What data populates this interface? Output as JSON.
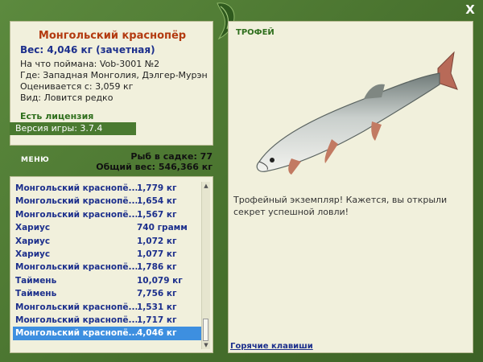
{
  "fish": {
    "title": "Монгольский краснопёр",
    "weight": "Вес: 4,046 кг (зачетная)",
    "caught_with": "На что поймана: Vob-3001 №2",
    "location": "Где: Западная Монголия, Дэлгер-Мурэн",
    "estimated_from": "Оценивается с: 3,059 кг",
    "rarity": "Вид: Ловится редко"
  },
  "license": "Есть лицензия",
  "version": "Версия игры: 3.7.4",
  "menu_label": "МЕНЮ",
  "stats": {
    "fish_in_keepnet": "Рыб в садке: 77",
    "total_weight": "Общий вес: 546,366 кг"
  },
  "catch_list": [
    {
      "name": "Монгольский краснопё...",
      "weight": "1,779 кг"
    },
    {
      "name": "Монгольский краснопё...",
      "weight": "1,654 кг"
    },
    {
      "name": "Монгольский краснопё...",
      "weight": "1,567 кг"
    },
    {
      "name": "Хариус",
      "weight": "740 грамм"
    },
    {
      "name": "Хариус",
      "weight": "1,072 кг"
    },
    {
      "name": "Хариус",
      "weight": "1,077 кг"
    },
    {
      "name": "Монгольский краснопё...",
      "weight": "1,786 кг"
    },
    {
      "name": "Таймень",
      "weight": "10,079 кг"
    },
    {
      "name": "Таймень",
      "weight": "7,756 кг"
    },
    {
      "name": "Монгольский краснопё...",
      "weight": "1,531 кг"
    },
    {
      "name": "Монгольский краснопё...",
      "weight": "1,717 кг"
    },
    {
      "name": "Монгольский краснопё...",
      "weight": "4,046 кг"
    }
  ],
  "selected_index": 11,
  "trophy": {
    "label": "ТРОФЕЙ",
    "text": "Трофейный экземпляр! Кажется, вы открыли секрет успешной ловли!"
  },
  "hotkeys_link": "Горячие клавиши",
  "close_glyph": "X",
  "colors": {
    "accent_green": "#4a7a30",
    "title_red": "#b33a10",
    "text_blue": "#1c2f8c",
    "selection_blue": "#3d8fe0"
  }
}
